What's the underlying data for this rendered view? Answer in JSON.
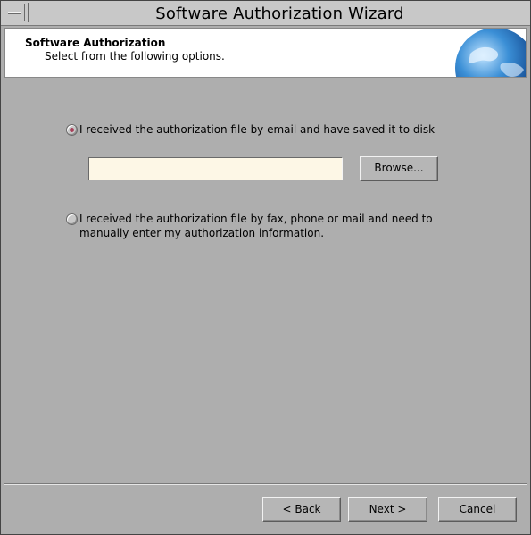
{
  "window": {
    "title": "Software Authorization Wizard"
  },
  "header": {
    "title": "Software Authorization",
    "subtitle": "Select from the following options."
  },
  "options": {
    "email": {
      "label": "I received the authorization file by email and have saved it to disk",
      "selected": true
    },
    "file_path": {
      "value": "",
      "placeholder": ""
    },
    "browse_label": "Browse...",
    "manual": {
      "line1": "I received the authorization file by fax, phone or mail and need to",
      "line2": "manually enter my authorization information.",
      "selected": false
    }
  },
  "footer": {
    "back_label": "< Back",
    "next_label": "Next >",
    "cancel_label": "Cancel"
  },
  "colors": {
    "window_bg": "#aeaeae",
    "field_bg": "#fdf7e6",
    "radio_dot": "#a8405a"
  },
  "icons": [
    "window-menu-icon",
    "globe-icon"
  ]
}
